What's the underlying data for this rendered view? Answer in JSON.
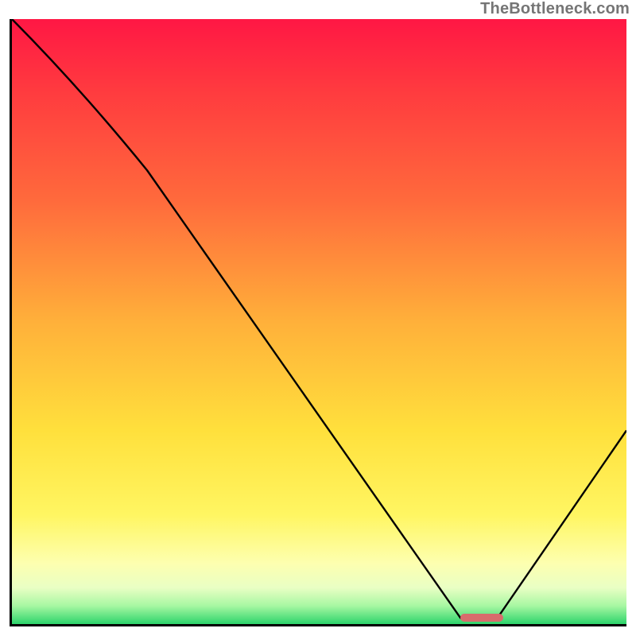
{
  "watermark": "TheBottleneck.com",
  "chart_data": {
    "type": "line",
    "title": "",
    "xlabel": "",
    "ylabel": "",
    "xlim": [
      0,
      100
    ],
    "ylim": [
      0,
      100
    ],
    "grid": false,
    "legend": false,
    "series": [
      {
        "name": "curve",
        "x": [
          0,
          22,
          73,
          79,
          100
        ],
        "y": [
          100,
          75,
          1,
          1,
          32
        ]
      }
    ],
    "marker": {
      "x_start": 73,
      "x_end": 80,
      "y": 1,
      "color": "#d86c6c"
    },
    "gradient_stops": [
      {
        "pos": 0,
        "color": "#ff1744"
      },
      {
        "pos": 12,
        "color": "#ff3b3f"
      },
      {
        "pos": 30,
        "color": "#ff6a3c"
      },
      {
        "pos": 50,
        "color": "#ffb03a"
      },
      {
        "pos": 68,
        "color": "#ffe03c"
      },
      {
        "pos": 82,
        "color": "#fff662"
      },
      {
        "pos": 90,
        "color": "#fdffb0"
      },
      {
        "pos": 94,
        "color": "#e9ffc4"
      },
      {
        "pos": 97,
        "color": "#a7f7a2"
      },
      {
        "pos": 100,
        "color": "#2dd46b"
      }
    ]
  },
  "plot": {
    "inner_w": 773,
    "inner_h": 761
  }
}
